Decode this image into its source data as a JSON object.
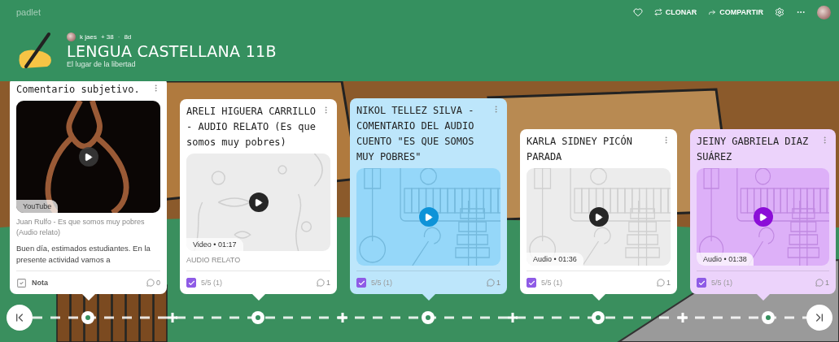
{
  "header": {
    "brand": "padlet",
    "author": {
      "name": "k jaes",
      "likes": "+ 38",
      "separator": "·",
      "age": "8d"
    },
    "title": "LENGUA CASTELLANA 11B",
    "subtitle": "El lugar de la libertad",
    "actions": [
      "CLONAR",
      "COMPARTIR"
    ]
  },
  "cards": [
    {
      "title": "Comentario subjetivo.",
      "color": "#ffffff",
      "media": {
        "kind": "youtube",
        "badge": "YouTube"
      },
      "caption": "Juan Rulfo - Es que somos muy pobres (Audio relato)",
      "description": "Buen día, estimados estudiantes. En la presente actividad vamos a",
      "footer": {
        "kind": "note",
        "label": "Nota"
      },
      "comments": "0"
    },
    {
      "title": "ARELI HIGUERA CARRILLO - AUDIO RELATO (Es que somos muy pobres)",
      "color": "#ffffff",
      "media": {
        "kind": "video",
        "badge": "Video • 01:17"
      },
      "caption": "AUDIO RELATO",
      "footer": {
        "kind": "checkbox",
        "label": "5/5 (1)",
        "checked": true
      },
      "comments": "1"
    },
    {
      "title": "NIKOL TELLEZ SILVA - COMENTARIO DEL AUDIO CUENTO \"ES QUE SOMOS MUY POBRES\"",
      "color": "#bde6fb",
      "media": {
        "kind": "audio"
      },
      "footer": {
        "kind": "checkbox",
        "label": "5/5 (1)",
        "checked": true
      },
      "comments": "1"
    },
    {
      "title": "KARLA SIDNEY PICÓN PARADA",
      "color": "#ffffff",
      "media": {
        "kind": "audio",
        "badge": "Audio • 01:36"
      },
      "footer": {
        "kind": "checkbox",
        "label": "5/5 (1)",
        "checked": true
      },
      "comments": "1"
    },
    {
      "title": "JEINY GABRIELA DIAZ SUÁREZ",
      "color": "#ecd3fb",
      "media": {
        "kind": "audio",
        "badge": "Audio • 01:38"
      },
      "footer": {
        "kind": "checkbox",
        "label": "5/5 (1)",
        "checked": true
      },
      "comments": "1"
    }
  ]
}
